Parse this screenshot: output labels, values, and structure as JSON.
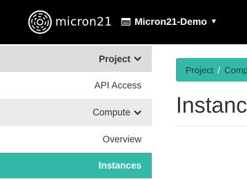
{
  "header": {
    "brand": "micron21",
    "project_switcher": "Micron21-Demo"
  },
  "sidebar": {
    "items": [
      {
        "label": "Project"
      },
      {
        "label": "API Access"
      },
      {
        "label": "Compute"
      },
      {
        "label": "Overview"
      },
      {
        "label": "Instances"
      }
    ]
  },
  "main": {
    "breadcrumb": [
      "Project",
      "Comp"
    ],
    "title": "Instanc"
  },
  "colors": {
    "accent": "#33b9a8",
    "topbar": "#000000"
  },
  "icons": [
    "micron21-logo-icon",
    "project-icon",
    "caret-down-icon",
    "chevron-down-icon"
  ]
}
